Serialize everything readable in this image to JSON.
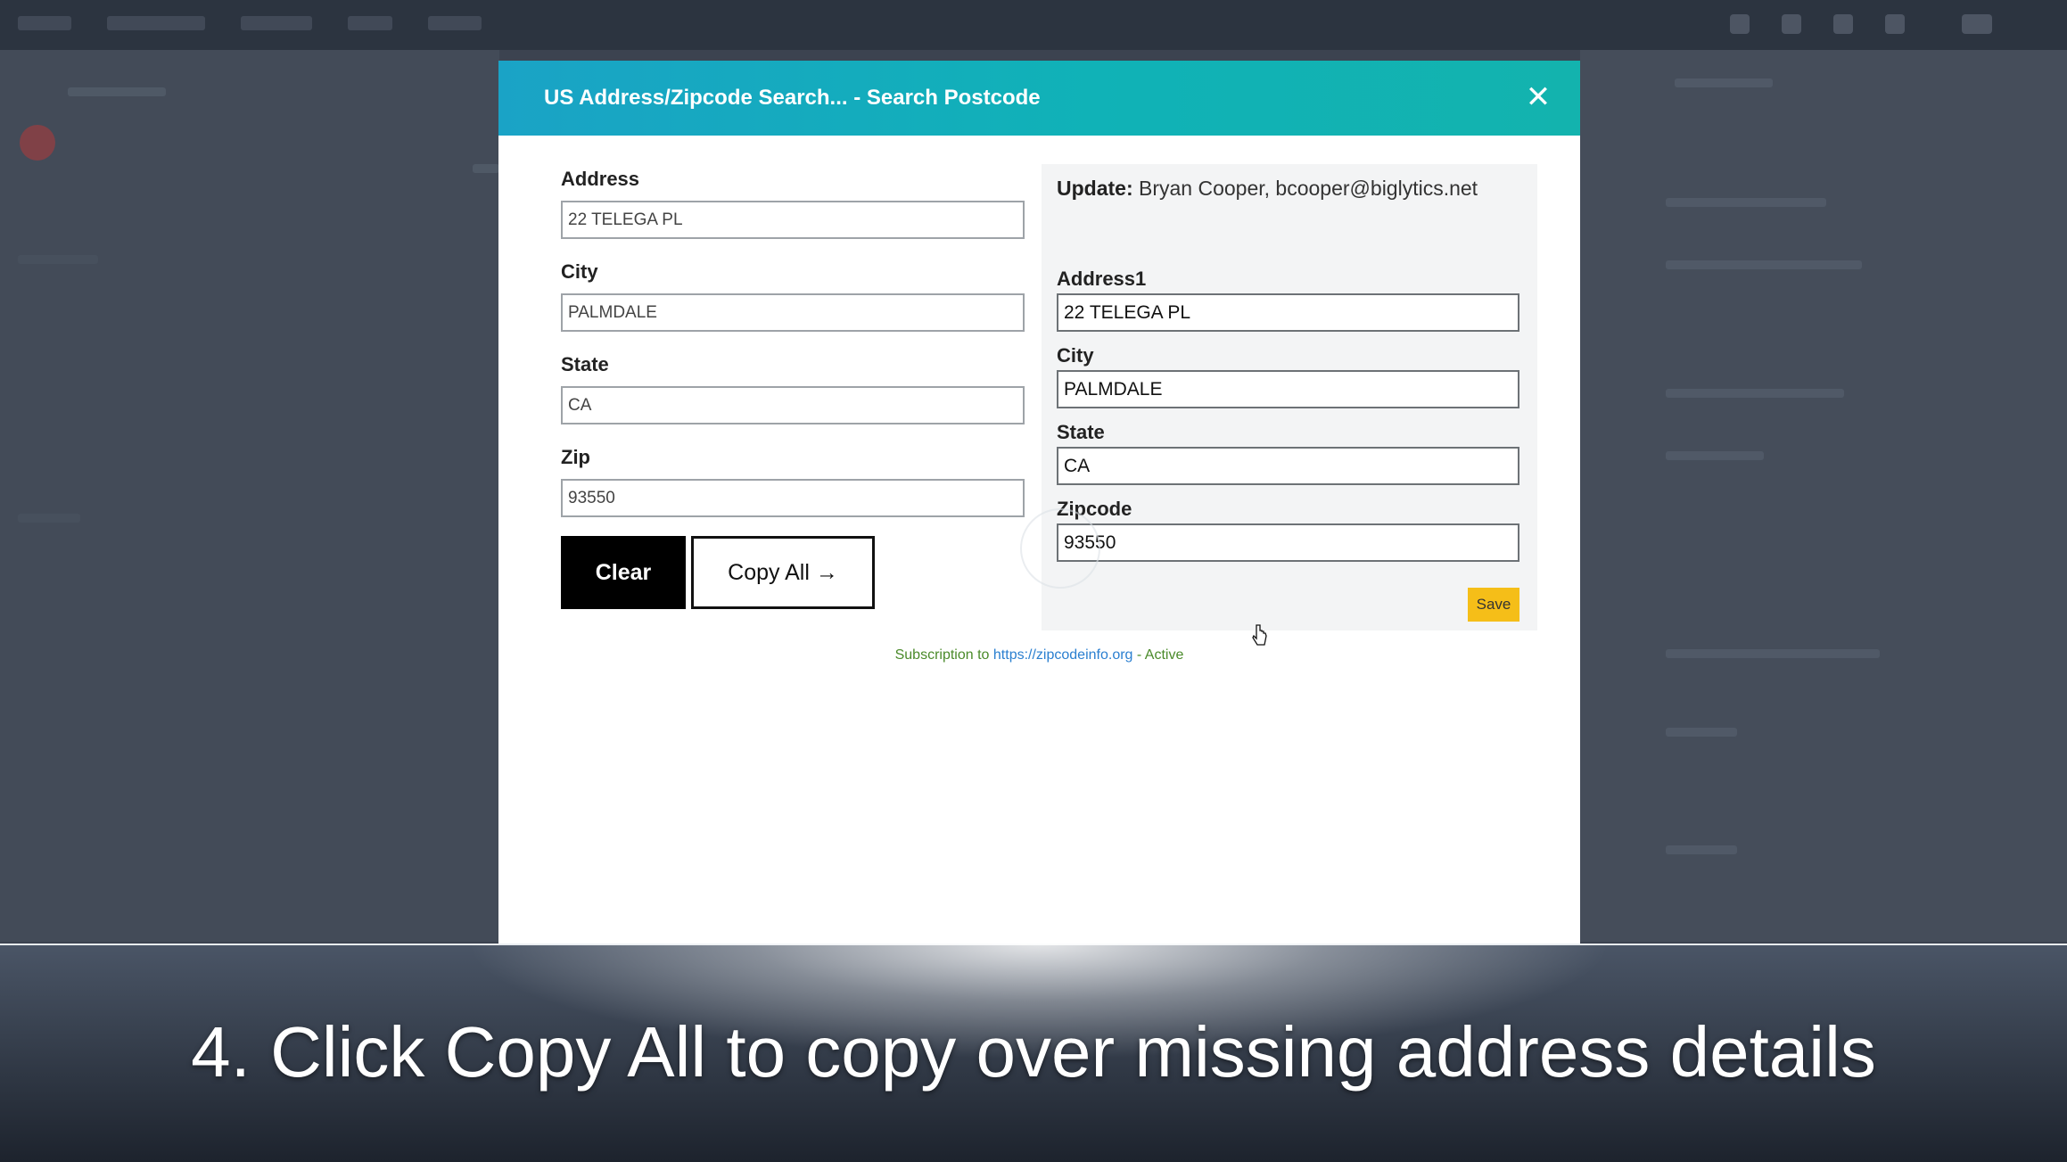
{
  "modal": {
    "title": "US Address/Zipcode Search... - Search Postcode",
    "close_icon": "close-icon",
    "search_form": {
      "address_label": "Address",
      "address_value": "22 TELEGA PL",
      "city_label": "City",
      "city_value": "PALMDALE",
      "state_label": "State",
      "state_value": "CA",
      "zip_label": "Zip",
      "zip_value": "93550"
    },
    "buttons": {
      "clear": "Clear",
      "copy_all": "Copy All →"
    },
    "update_panel": {
      "update_label": "Update:",
      "update_contact": "Bryan Cooper, bcooper@biglytics.net",
      "address1_label": "Address1",
      "address1_value": "22 TELEGA PL",
      "city_label": "City",
      "city_value": "PALMDALE",
      "state_label": "State",
      "state_value": "CA",
      "zipcode_label": "Zipcode",
      "zipcode_value": "93550",
      "save_label": "Save"
    },
    "subscription": {
      "prefix": "Subscription to",
      "link": "https://zipcodeinfo.org",
      "suffix": "- Active"
    }
  },
  "caption": {
    "text": "4. Click Copy All to copy over missing address details"
  },
  "colors": {
    "header_start": "#1aa3c6",
    "header_end": "#13b3ae",
    "save_button": "#f5be18",
    "clear_button": "#000000"
  }
}
